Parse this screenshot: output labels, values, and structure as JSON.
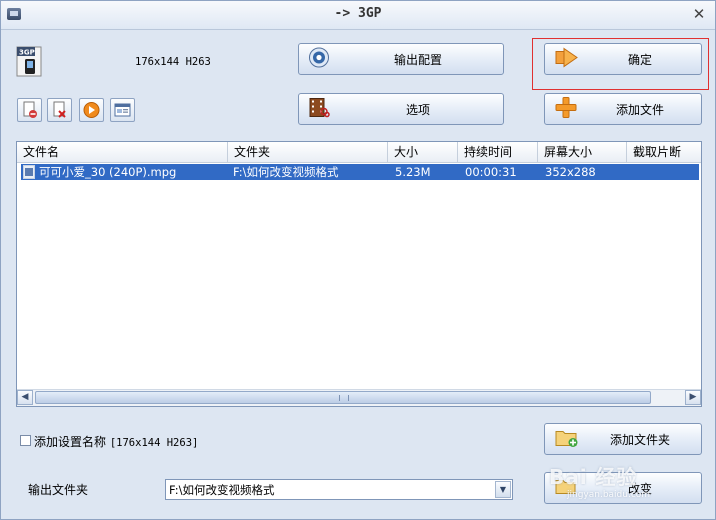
{
  "window": {
    "title": "-> 3GP"
  },
  "format": {
    "profile_text": "176x144 H263",
    "file_icon_label": "3GP"
  },
  "buttons": {
    "output_config": "输出配置",
    "confirm": "确定",
    "options": "选项",
    "add_file": "添加文件",
    "add_folder": "添加文件夹",
    "change": "改变"
  },
  "toolbar": {
    "small_buttons": [
      "remove-file-icon",
      "clear-list-icon",
      "play-icon",
      "info-icon"
    ]
  },
  "file_list": {
    "columns": [
      "文件名",
      "文件夹",
      "大小",
      "持续时间",
      "屏幕大小",
      "截取片断"
    ],
    "rows": [
      {
        "name": "可可小爱_30 (240P).mpg",
        "folder": "F:\\如何改变视频格式",
        "size": "5.23M",
        "duration": "00:00:31",
        "screen_size": "352x288",
        "clip": ""
      }
    ]
  },
  "settings": {
    "add_setting_name_label": "添加设置名称",
    "add_setting_name_value": "[176x144 H263]",
    "add_setting_name_checked": false
  },
  "output": {
    "label": "输出文件夹",
    "folder_value": "F:\\如何改变视频格式"
  },
  "watermark": {
    "brand": "Bai 经验",
    "url": "jingyan.baidu.com"
  },
  "colors": {
    "selection": "#316ac5",
    "focus_outline": "#e03030",
    "window_bg": "#dde6f2"
  }
}
